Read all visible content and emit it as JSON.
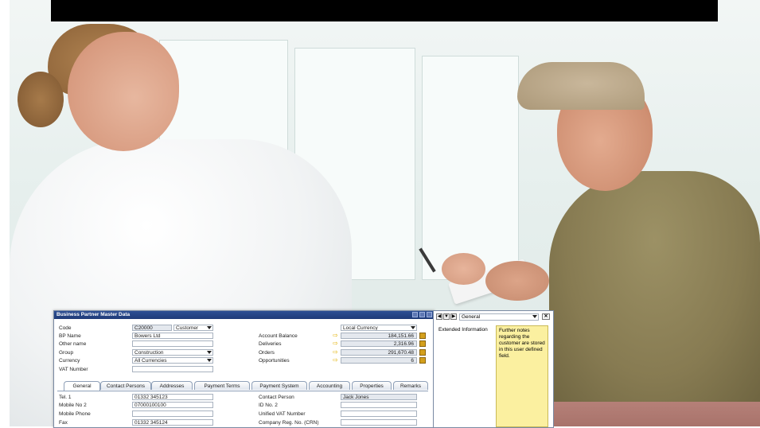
{
  "window": {
    "title": "Business Partner Master Data",
    "fields": {
      "code_label": "Code",
      "code_value": "C20000",
      "type_value": "Customer",
      "bp_name_label": "BP Name",
      "bp_name_value": "Bowers Ltd",
      "other_name_label": "Other name",
      "group_label": "Group",
      "group_value": "Construction",
      "currency_label": "Currency",
      "currency_value": "All Currencies",
      "vat_label": "VAT Number",
      "balance_currency": "Local Currency",
      "account_balance_label": "Account Balance",
      "account_balance_value": "184,151.66",
      "deliveries_label": "Deliveries",
      "deliveries_value": "2,316.96",
      "orders_label": "Orders",
      "orders_value": "291,670.48",
      "opportunities_label": "Opportunities",
      "opportunities_value": "6"
    },
    "tabs": [
      "General",
      "Contact Persons",
      "Addresses",
      "Payment Terms",
      "Payment System",
      "Accounting",
      "Properties",
      "Remarks"
    ],
    "general": {
      "tel1_label": "Tel. 1",
      "tel1_value": "01332 345123",
      "mobile2_label": "Mobile No 2",
      "mobile2_value": "07000100100",
      "mobile_label": "Mobile Phone",
      "fax_label": "Fax",
      "fax_value": "01332 345124",
      "contact_label": "Contact Person",
      "contact_value": "Jack Jones",
      "id2_label": "ID No. 2",
      "unified_vat_label": "Unified VAT Number",
      "company_reg_label": "Company Reg. No. (CRN)"
    }
  },
  "side_panel": {
    "category": "General",
    "field_label": "Extended Information",
    "note_text": "Further notes regarding the customer are stored in this user defined field."
  },
  "colors": {
    "title_bar": "#1f3b78",
    "note_bg": "#fbf0a0",
    "link_arrow": "#e2b100"
  }
}
